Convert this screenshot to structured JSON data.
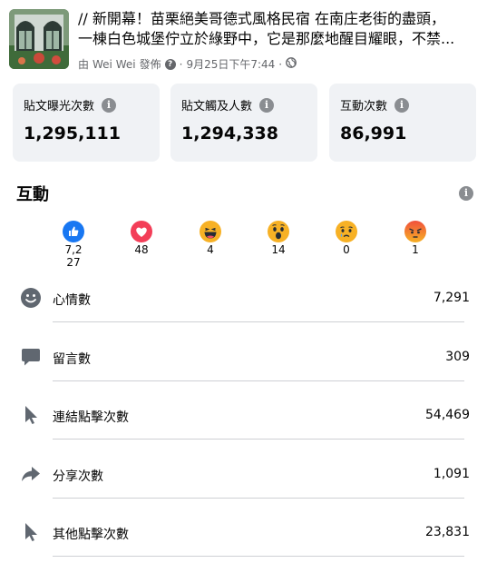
{
  "post": {
    "line1": "// 新開幕！苗栗絕美哥德式風格民宿 在南庄老街的盡頭，",
    "line2": "一棟白色城堡佇立於綠野中，它是那麼地醒目耀眼，不禁...",
    "meta_prefix": "由",
    "author": "Wei Wei",
    "meta_suffix": "發佈",
    "date": "9月25日下午7:44"
  },
  "cards": [
    {
      "label": "貼文曝光次數",
      "value": "1,295,111"
    },
    {
      "label": "貼文觸及人數",
      "value": "1,294,338"
    },
    {
      "label": "互動次數",
      "value": "86,991"
    }
  ],
  "section": {
    "title": "互動"
  },
  "reactions": [
    {
      "name": "like",
      "count": "7,227"
    },
    {
      "name": "love",
      "count": "48"
    },
    {
      "name": "haha",
      "count": "4"
    },
    {
      "name": "wow",
      "count": "14"
    },
    {
      "name": "sad",
      "count": "0"
    },
    {
      "name": "angry",
      "count": "1"
    }
  ],
  "metrics": [
    {
      "label": "心情數",
      "value": "7,291",
      "icon": "smiley-icon"
    },
    {
      "label": "留言數",
      "value": "309",
      "icon": "comment-icon"
    },
    {
      "label": "連結點擊次數",
      "value": "54,469",
      "icon": "cursor-icon"
    },
    {
      "label": "分享次數",
      "value": "1,091",
      "icon": "share-icon"
    },
    {
      "label": "其他點擊次數",
      "value": "23,831",
      "icon": "cursor-icon"
    }
  ],
  "colors": {
    "card_bg": "#f0f2f5",
    "like": "#1877f2",
    "love": "#f33e58",
    "emoji": "#f7b125",
    "angry": "#e9710f",
    "icon_gray": "#606770",
    "divider": "#ced0d4"
  }
}
